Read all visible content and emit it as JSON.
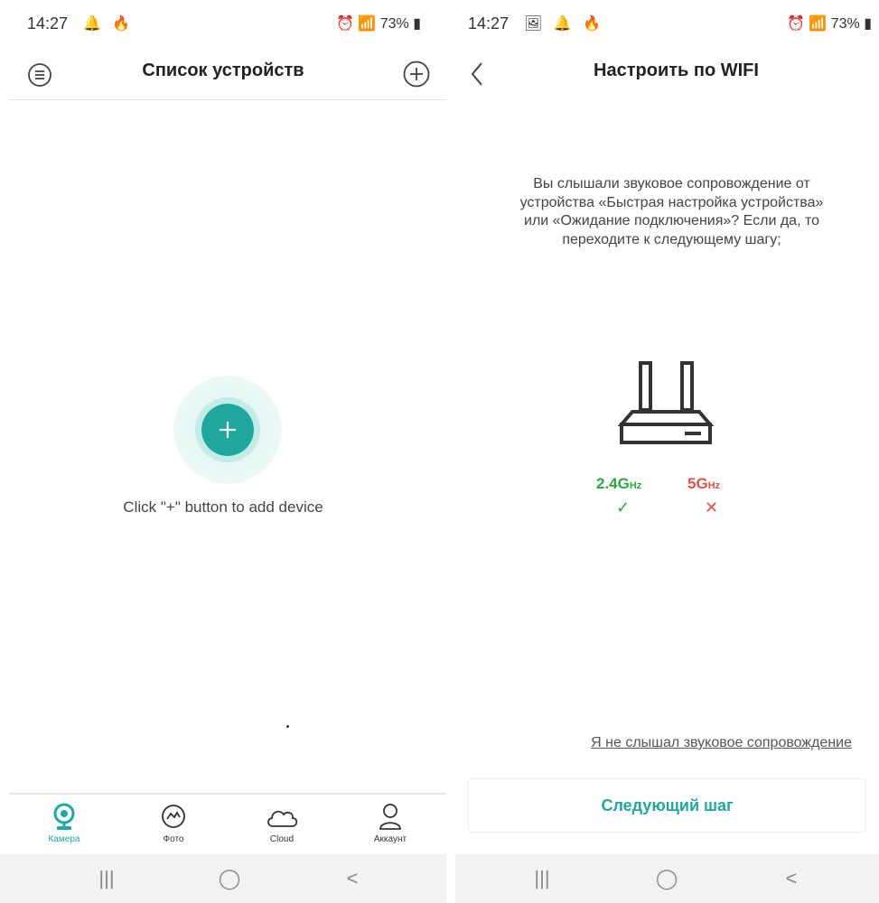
{
  "left_screen": {
    "status": {
      "time": "14:27",
      "icons": "🔔 🔥",
      "battery": "73%"
    },
    "title": "Список устройств",
    "empty_text": "Click \"+\" button to add device",
    "tabs": [
      {
        "label": "Камера",
        "icon": "camera-icon",
        "active": true
      },
      {
        "label": "Фото",
        "icon": "photo-icon",
        "active": false
      },
      {
        "label": "Cloud",
        "icon": "cloud-icon",
        "active": false
      },
      {
        "label": "Аккаунт",
        "icon": "account-icon",
        "active": false
      }
    ]
  },
  "right_screen": {
    "status": {
      "time": "14:27",
      "icons": "🖼 🔔 🔥",
      "battery": "73%"
    },
    "title": "Настроить по WIFI",
    "description": "Вы слышали звуковое сопровождение от устройства «Быстрая настройка устройства» или «Ожидание подключения»? Если да, то переходите к следующему шагу;",
    "band_24": {
      "main": "2.4G",
      "suffix": "Hz",
      "mark": "✓",
      "color": "#2fa845"
    },
    "band_5": {
      "main": "5G",
      "suffix": "Hz",
      "mark": "✕",
      "color": "#e0524a"
    },
    "link": "Я не слышал звуковое сопровождение",
    "next_button": "Следующий шаг"
  },
  "navbar": {
    "recent": "|||",
    "home": "◯",
    "back": "<"
  },
  "colors": {
    "accent": "#20a7a0",
    "ok": "#2fa845",
    "bad": "#e0524a"
  }
}
